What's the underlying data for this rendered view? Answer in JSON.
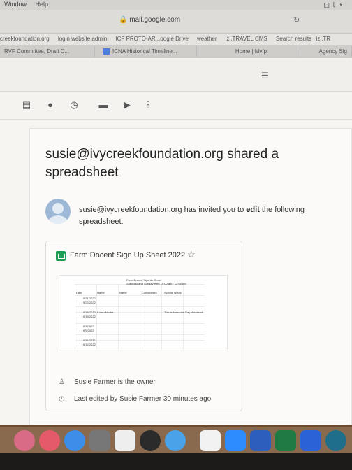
{
  "menubar": {
    "items": [
      "Window",
      "Help"
    ]
  },
  "browser": {
    "url": "mail.google.com",
    "bookmarks": [
      "creekfoundation.org",
      "login website admin",
      "ICF PROTO-AR...oogle Drive",
      "weather",
      "izi.TRAVEL CMS",
      "Search results | izi.TR"
    ],
    "tabs": [
      "RVF Committee, Draft C...",
      "ICNA Historical Timeline...",
      "Home | Mvfp",
      "Agency Sig"
    ]
  },
  "email": {
    "heading": "susie@ivycreekfoundation.org shared a spreadsheet",
    "sender": "susie@ivycreekfoundation.org",
    "invite_mid": " has invited you to ",
    "invite_bold": "edit",
    "invite_end": " the following spreadsheet:",
    "file_name": "Farm Docent Sign Up Sheet 2022",
    "owner_text": "Susie Farmer is the owner",
    "edited_text": "Last edited by Susie Farmer 30 minutes ago"
  },
  "preview": {
    "title": "Farm Docent Sign Up Sheet",
    "subtitle": "Saturday and Sunday from 10:00 am - 12:00 pm",
    "headers": [
      "Date",
      "Name",
      "Name",
      "Contact Info",
      "Special Notes"
    ],
    "dates": [
      "5/21/2022",
      "5/22/2022",
      "6/18/2022",
      "6/19/2022",
      "6/4/2022",
      "6/5/2022",
      "6/11/2022",
      "6/12/2022"
    ],
    "row_name": "Karen Moder",
    "row_note": "This is Memorial Day Weekend"
  },
  "icons": [
    "archive-icon",
    "report-icon",
    "clock-icon",
    "check-icon",
    "folder-icon",
    "label-icon",
    "more-icon",
    "filter-icon",
    "star-icon",
    "person-icon",
    "history-icon"
  ],
  "colors": {
    "sheets_green": "#1e9e55",
    "dock_bg": "#8a6a4e"
  }
}
